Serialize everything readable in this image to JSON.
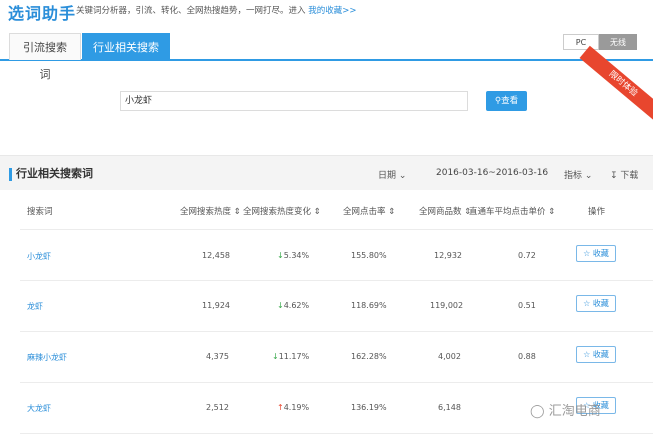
{
  "header": {
    "brand": "选词助手",
    "description": "关键词分析器，引流、转化、全网热搜趋势，一网打尽。进入",
    "link": "我的收藏>>"
  },
  "tabs": [
    "引流搜索词",
    "行业相关搜索词"
  ],
  "device": {
    "pc": "PC",
    "wireless": "无线"
  },
  "ribbon": "限时体验",
  "search": {
    "value": "小龙虾",
    "button": "查看"
  },
  "panel": {
    "title": "行业相关搜索词",
    "date_label": "日期",
    "date_range": "2016-03-16~2016-03-16",
    "metric_label": "指标",
    "download_label": "下载"
  },
  "table": {
    "headers": [
      "搜索词",
      "全网搜索热度",
      "全网搜索热度变化",
      "全网点击率",
      "全网商品数",
      "直通车平均点击单价",
      "操作"
    ],
    "rows": [
      {
        "keyword": "小龙虾",
        "heat": "12,458",
        "change": "5.34%",
        "direction": "down",
        "ctr": "155.80%",
        "items": "12,932",
        "cpc": "0.72",
        "action": "收藏"
      },
      {
        "keyword": "龙虾",
        "heat": "11,924",
        "change": "4.62%",
        "direction": "down",
        "ctr": "118.69%",
        "items": "119,002",
        "cpc": "0.51",
        "action": "收藏"
      },
      {
        "keyword": "麻辣小龙虾",
        "heat": "4,375",
        "change": "11.17%",
        "direction": "down",
        "ctr": "162.28%",
        "items": "4,002",
        "cpc": "0.88",
        "action": "收藏"
      },
      {
        "keyword": "大龙虾",
        "heat": "2,512",
        "change": "4.19%",
        "direction": "up",
        "ctr": "136.19%",
        "items": "6,148",
        "cpc": "",
        "action": "收藏"
      }
    ]
  },
  "watermark": "汇淘电商"
}
